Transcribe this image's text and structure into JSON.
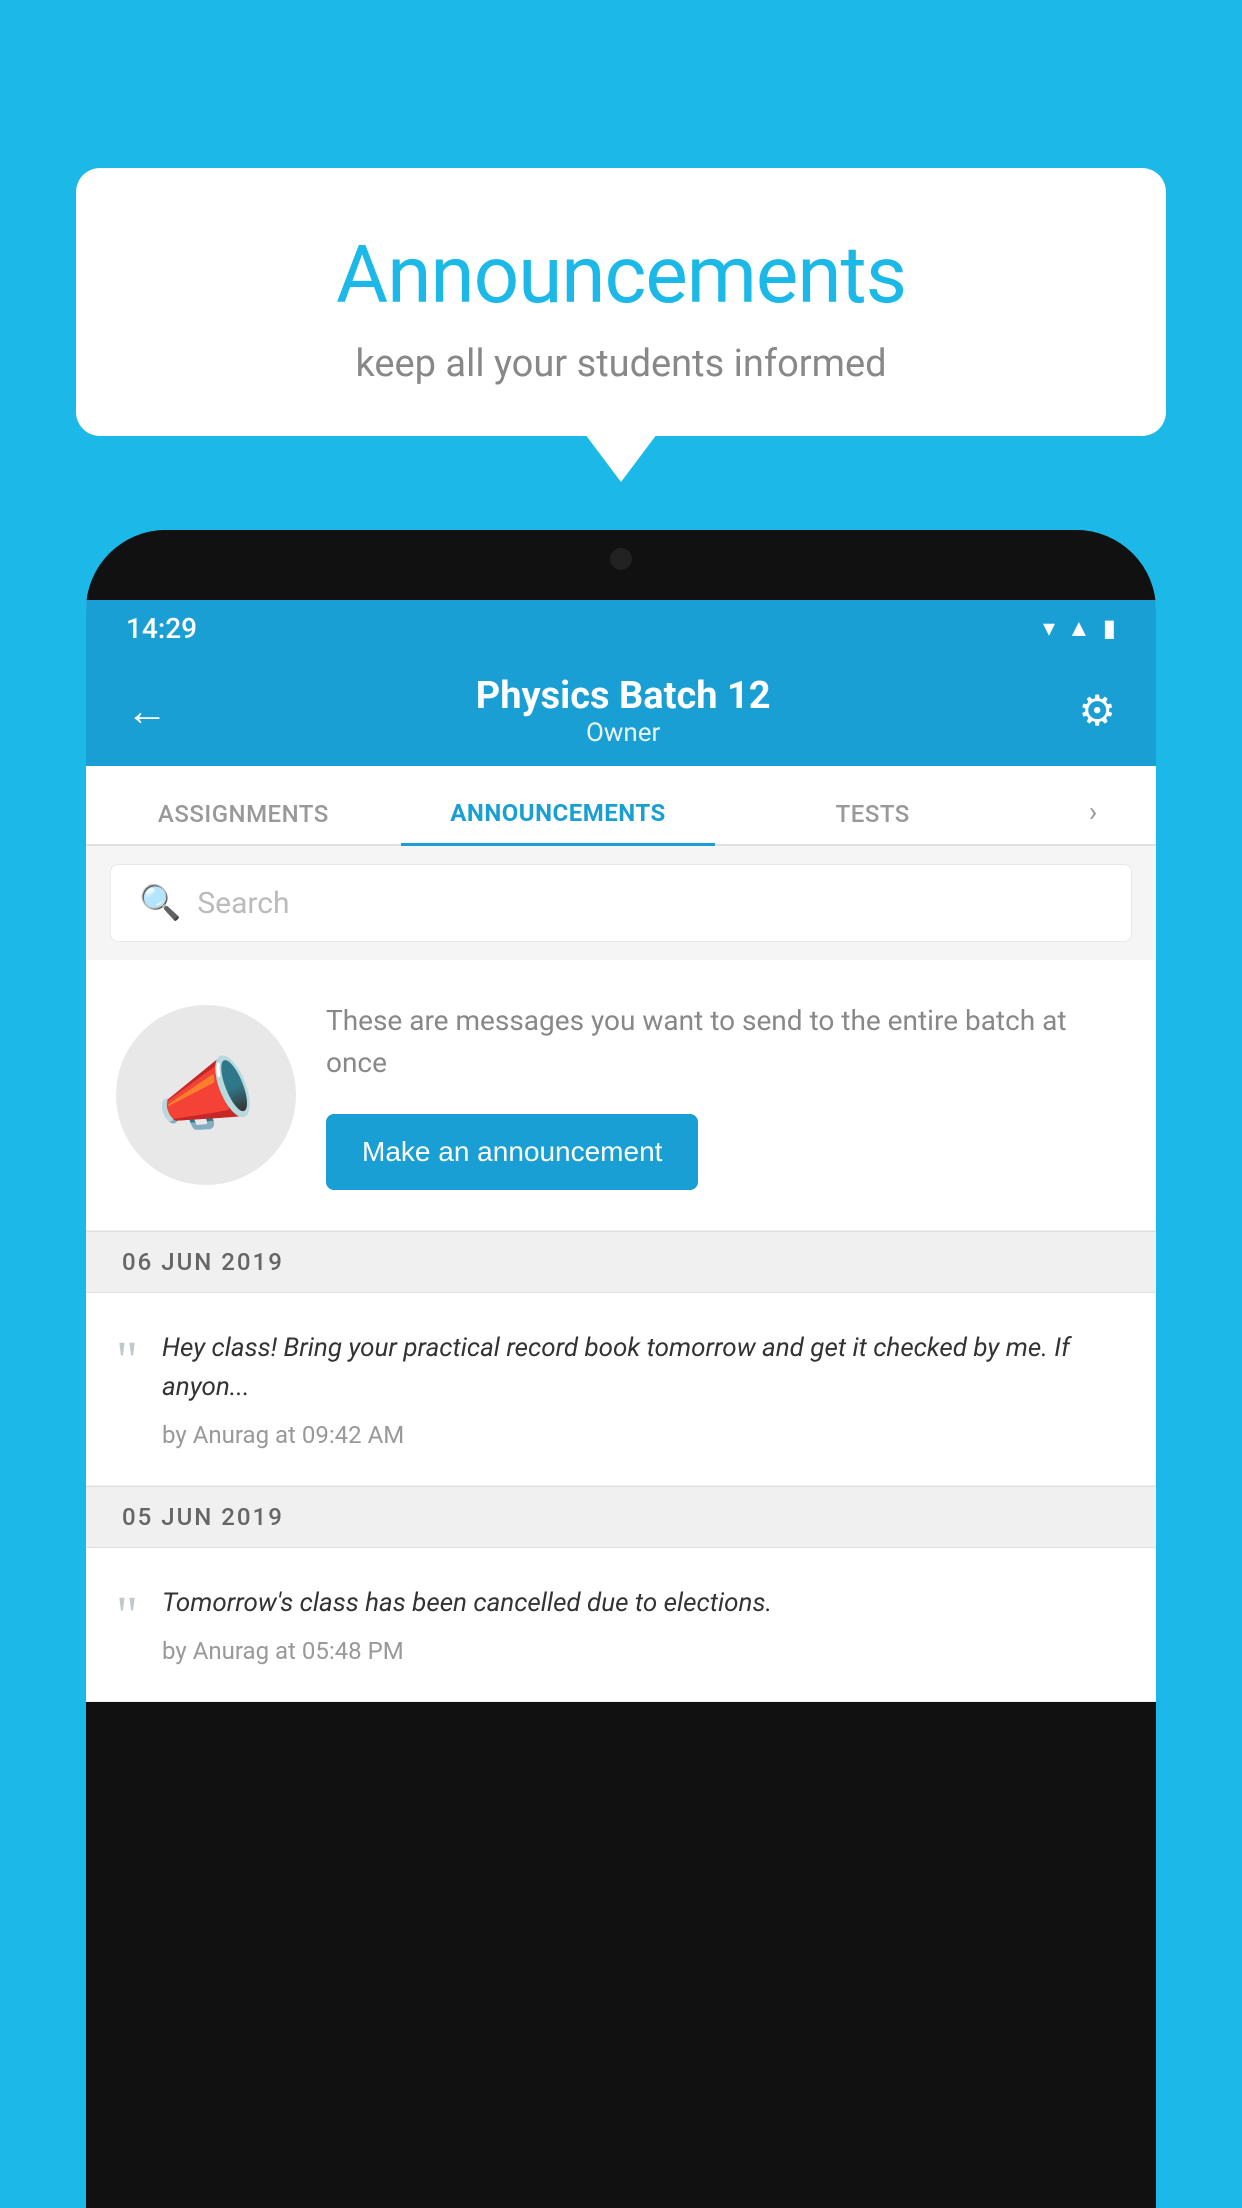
{
  "background_color": "#1BB8E8",
  "speech_bubble": {
    "title": "Announcements",
    "subtitle": "keep all your students informed"
  },
  "phone": {
    "status_bar": {
      "time": "14:29",
      "icons": [
        "wifi",
        "signal",
        "battery"
      ]
    },
    "header": {
      "title": "Physics Batch 12",
      "subtitle": "Owner",
      "back_label": "←",
      "gear_label": "⚙"
    },
    "tabs": [
      {
        "label": "ASSIGNMENTS",
        "active": false
      },
      {
        "label": "ANNOUNCEMENTS",
        "active": true
      },
      {
        "label": "TESTS",
        "active": false
      }
    ],
    "search": {
      "placeholder": "Search"
    },
    "empty_state": {
      "description": "These are messages you want to send to the entire batch at once",
      "button_label": "Make an announcement"
    },
    "announcements": [
      {
        "date": "06  JUN  2019",
        "text": "Hey class! Bring your practical record book tomorrow and get it checked by me. If anyon...",
        "meta": "by Anurag at 09:42 AM"
      },
      {
        "date": "05  JUN  2019",
        "text": "Tomorrow's class has been cancelled due to elections.",
        "meta": "by Anurag at 05:48 PM"
      }
    ]
  }
}
